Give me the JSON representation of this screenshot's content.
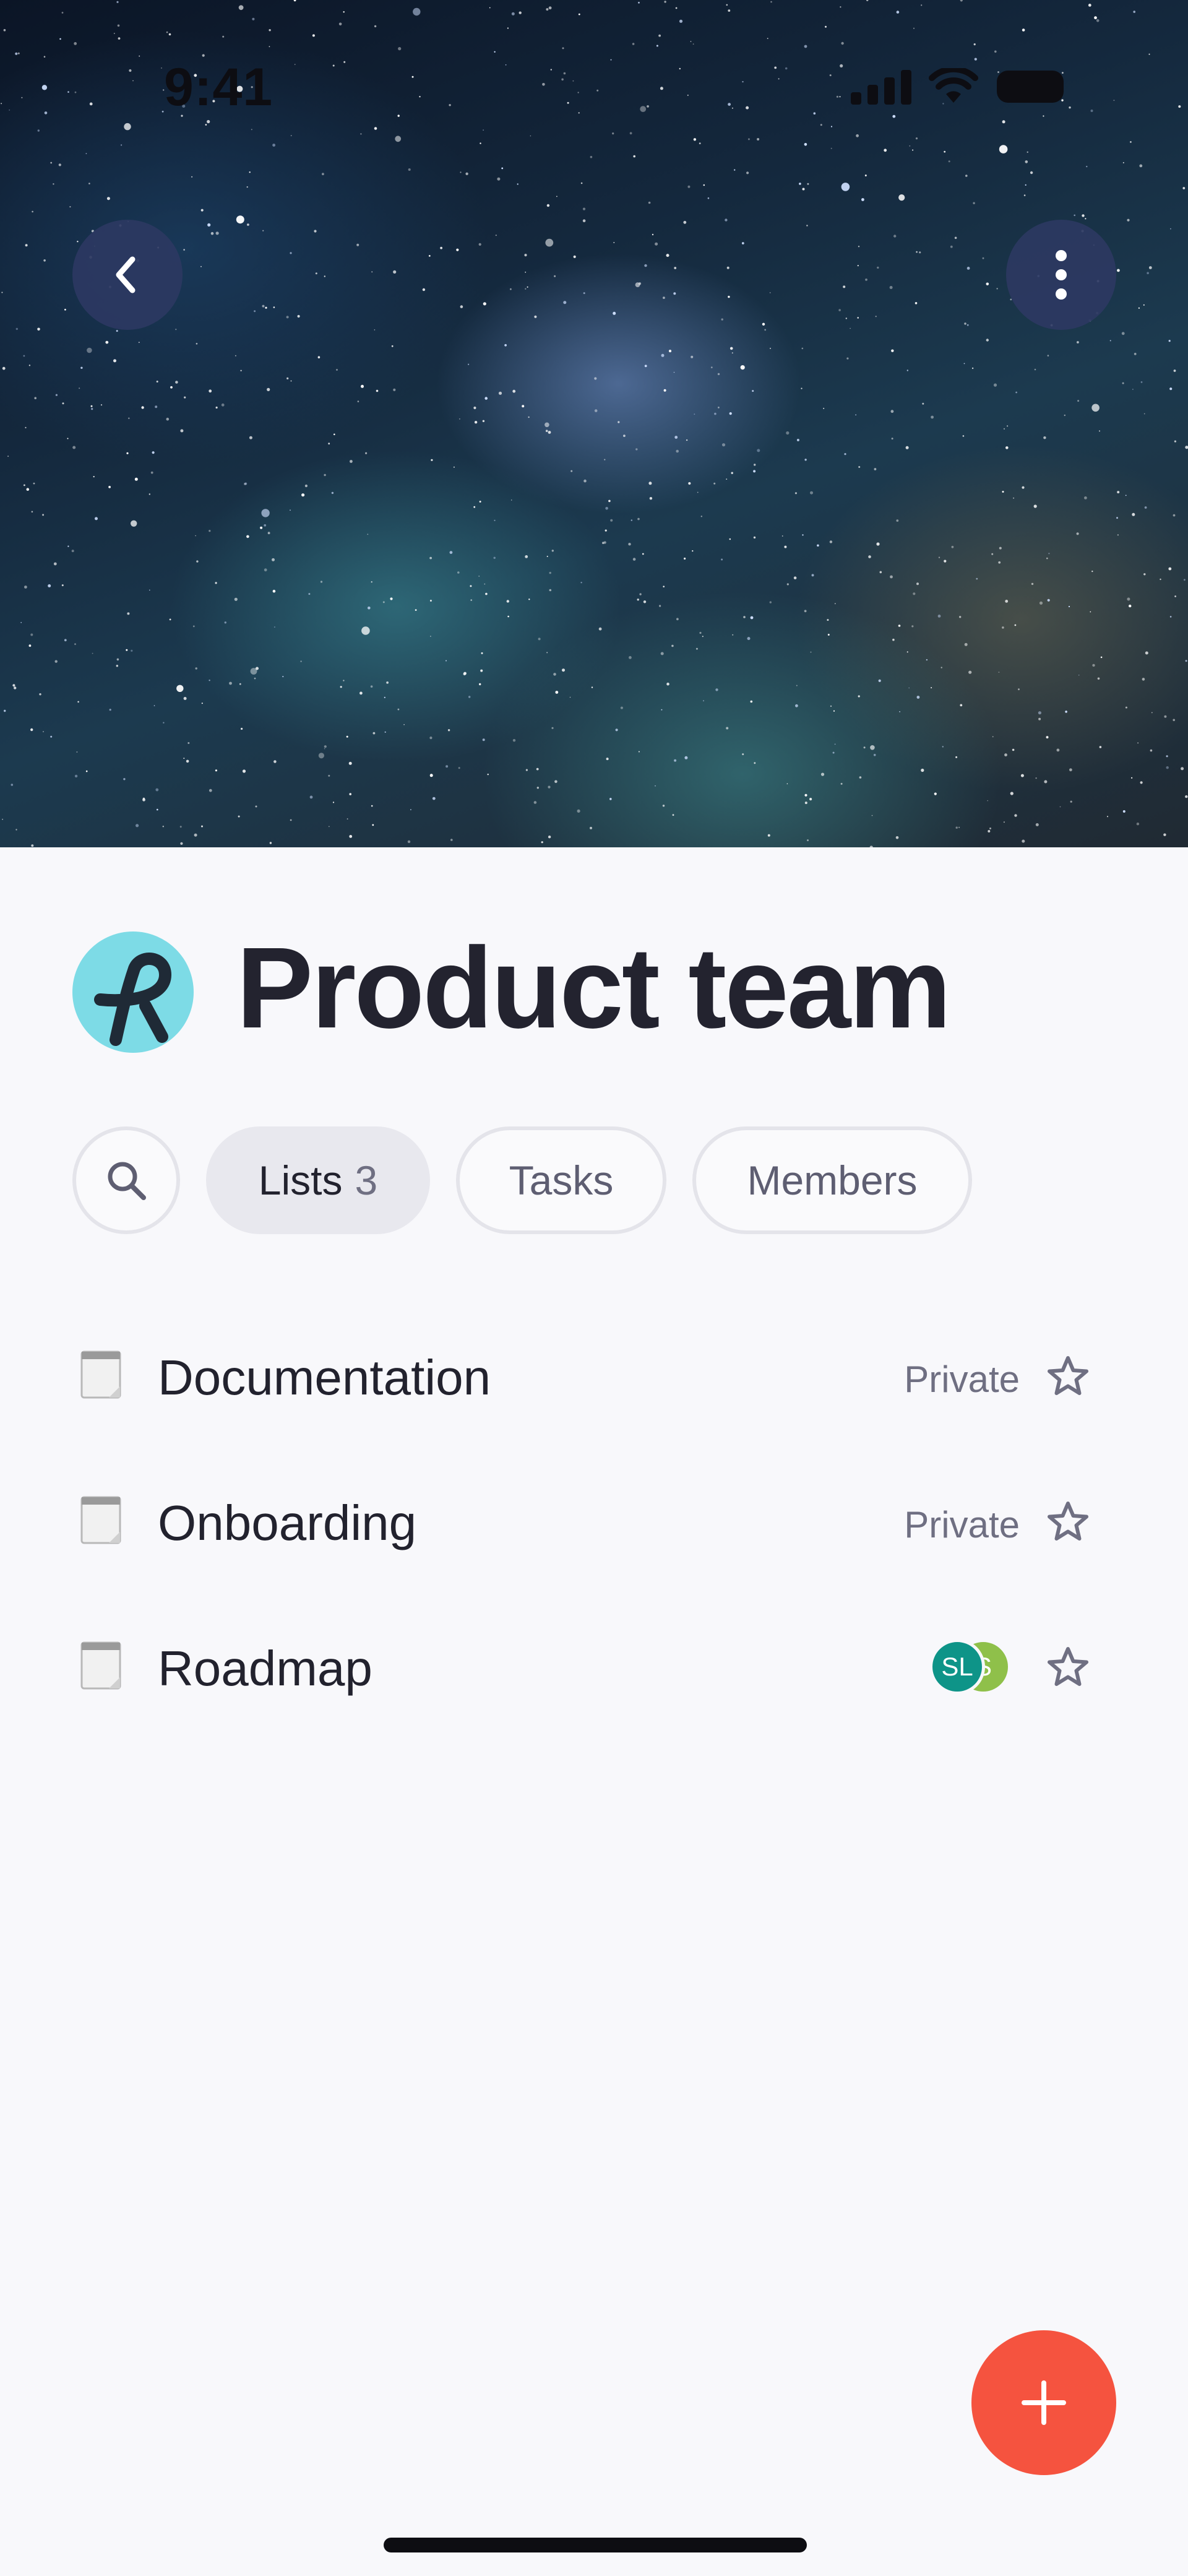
{
  "status_bar": {
    "time": "9:41"
  },
  "header": {
    "back_icon": "chevron-left-icon",
    "more_icon": "vertical-ellipsis-icon"
  },
  "team": {
    "title": "Product team",
    "logo_color": "#7ddbe6"
  },
  "tabs": [
    {
      "icon": "search-icon"
    },
    {
      "label": "Lists",
      "count": "3",
      "active": true
    },
    {
      "label": "Tasks",
      "active": false
    },
    {
      "label": "Members",
      "active": false
    }
  ],
  "lists": [
    {
      "title": "Documentation",
      "privacy": "Private",
      "icon": "notepad-icon",
      "star_icon": "star-outline-icon"
    },
    {
      "title": "Onboarding",
      "privacy": "Private",
      "icon": "notepad-icon",
      "star_icon": "star-outline-icon"
    },
    {
      "title": "Roadmap",
      "icon": "notepad-icon",
      "star_icon": "star-outline-icon",
      "members": [
        {
          "initials": "SL",
          "color": "#0e9488"
        },
        {
          "initials": "S",
          "color": "#8fc04a"
        }
      ]
    }
  ],
  "fab": {
    "icon": "plus-icon",
    "color": "#f5533f"
  }
}
